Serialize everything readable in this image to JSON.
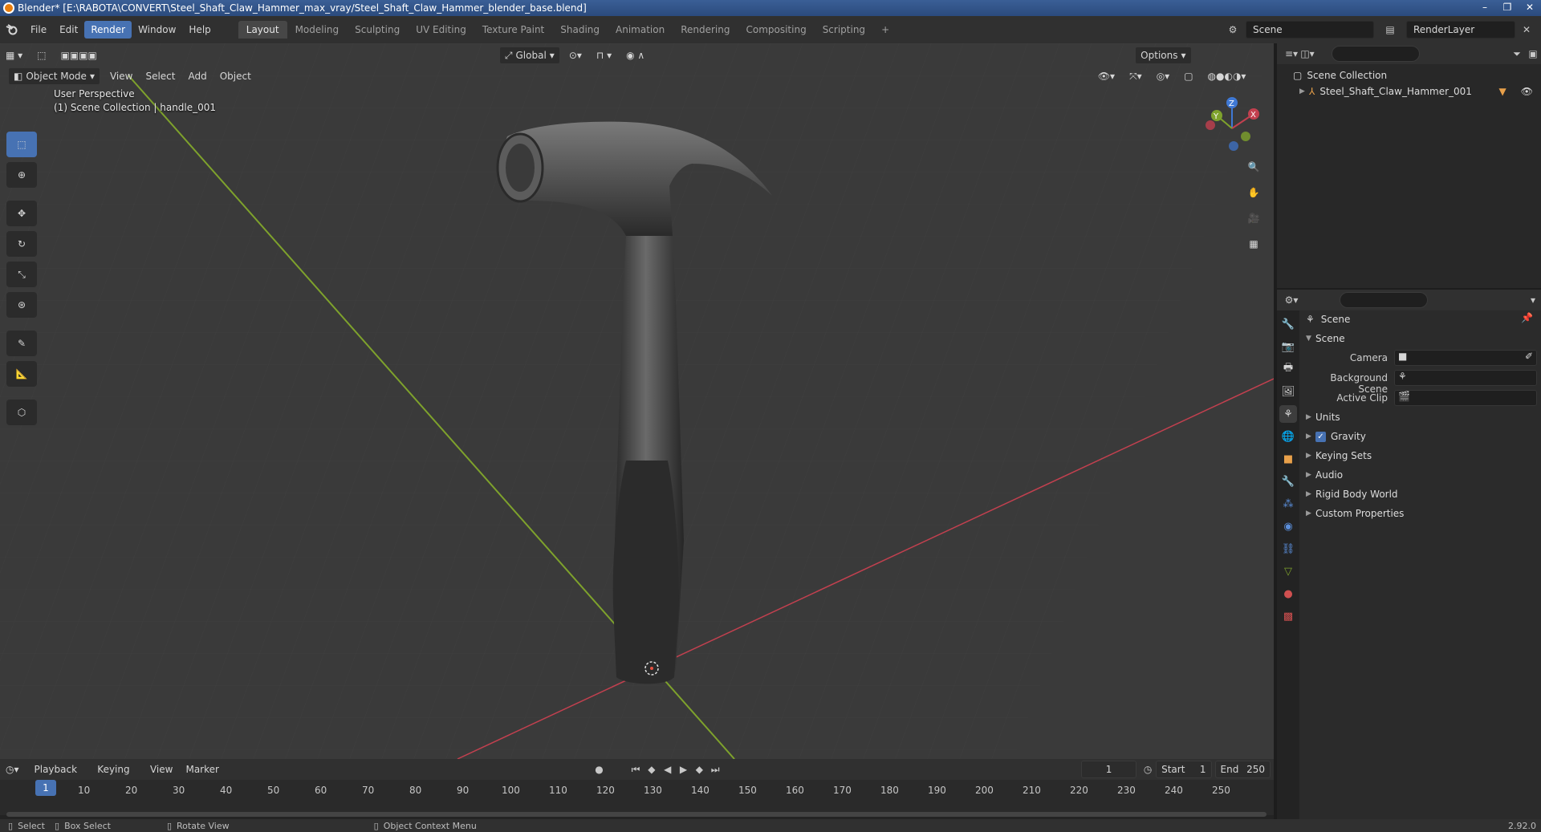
{
  "window": {
    "title": "Blender* [E:\\RABOTA\\CONVERT\\Steel_Shaft_Claw_Hammer_max_vray/Steel_Shaft_Claw_Hammer_blender_base.blend]"
  },
  "menus": [
    "File",
    "Edit",
    "Render",
    "Window",
    "Help"
  ],
  "workspaces": [
    "Layout",
    "Modeling",
    "Sculpting",
    "UV Editing",
    "Texture Paint",
    "Shading",
    "Animation",
    "Rendering",
    "Compositing",
    "Scripting"
  ],
  "topbar": {
    "scene": "Scene",
    "render_layer": "RenderLayer"
  },
  "viewport": {
    "mode": "Object Mode",
    "header_menus": [
      "View",
      "Select",
      "Add",
      "Object"
    ],
    "orientation": "Global",
    "options": "Options",
    "perspective_label": "User Perspective",
    "collection_label": "(1) Scene Collection | handle_001"
  },
  "timeline": {
    "menus": [
      "Playback",
      "Keying",
      "View",
      "Marker"
    ],
    "current_frame": "1",
    "start_label": "Start",
    "start": "1",
    "end_label": "End",
    "end": "250",
    "playhead": "1",
    "ticks": [
      "10",
      "20",
      "30",
      "40",
      "50",
      "60",
      "70",
      "80",
      "90",
      "100",
      "110",
      "120",
      "130",
      "140",
      "150",
      "160",
      "170",
      "180",
      "190",
      "200",
      "210",
      "220",
      "230",
      "240",
      "250"
    ]
  },
  "statusbar": {
    "select": "Select",
    "box_select": "Box Select",
    "rotate": "Rotate View",
    "context": "Object Context Menu",
    "version": "2.92.0"
  },
  "outliner": {
    "root": "Scene Collection",
    "item": "Steel_Shaft_Claw_Hammer_001"
  },
  "properties": {
    "context": "Scene",
    "panel": "Scene",
    "camera_label": "Camera",
    "background_label": "Background Scene",
    "clip_label": "Active Clip",
    "sections": [
      "Units",
      "Gravity",
      "Keying Sets",
      "Audio",
      "Rigid Body World",
      "Custom Properties"
    ]
  },
  "colors": {
    "accent": "#4772b3",
    "x_axis": "#c2404f",
    "y_axis": "#7ea22c",
    "z_axis": "#3f78d4"
  }
}
